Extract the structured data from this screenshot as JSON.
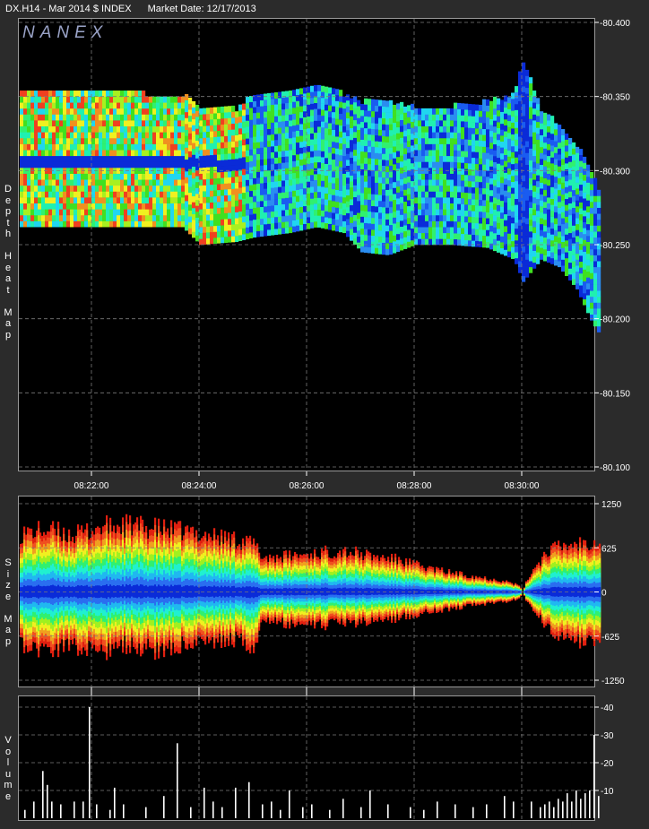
{
  "header": {
    "symbol": "DX.H14 - Mar 2014 $ INDEX",
    "market_date": "Market Date: 12/17/2013"
  },
  "watermark": "NANEX",
  "panels": {
    "heat": {
      "label": "Depth Heat Map"
    },
    "size": {
      "label": "Size Map"
    },
    "volume": {
      "label": "Volume"
    }
  },
  "chart_data": [
    {
      "type": "heatmap",
      "title": "",
      "xlabel": "",
      "ylabel": "Depth Heat Map",
      "x_ticks": [
        "08:22:00",
        "08:24:00",
        "08:26:00",
        "08:28:00",
        "08:30:00"
      ],
      "y_ticks": [
        "80.400",
        "80.350",
        "80.300",
        "80.250",
        "80.200",
        "80.150",
        "80.100"
      ],
      "ylim": [
        80.1,
        80.4
      ],
      "xlim": [
        "08:20:40",
        "08:31:30"
      ],
      "grid": true,
      "price_band": [
        {
          "t": "08:20:40",
          "low": 80.262,
          "high": 80.352
        },
        {
          "t": "08:21:40",
          "low": 80.262,
          "high": 80.352
        },
        {
          "t": "08:22:10",
          "low": 80.262,
          "high": 80.352
        },
        {
          "t": "08:23:00",
          "low": 80.262,
          "high": 80.35
        },
        {
          "t": "08:23:40",
          "low": 80.262,
          "high": 80.35
        },
        {
          "t": "08:24:00",
          "low": 80.25,
          "high": 80.34
        },
        {
          "t": "08:24:40",
          "low": 80.252,
          "high": 80.34
        },
        {
          "t": "08:25:00",
          "low": 80.255,
          "high": 80.35
        },
        {
          "t": "08:25:40",
          "low": 80.258,
          "high": 80.352
        },
        {
          "t": "08:26:10",
          "low": 80.262,
          "high": 80.355
        },
        {
          "t": "08:26:40",
          "low": 80.258,
          "high": 80.35
        },
        {
          "t": "08:27:00",
          "low": 80.245,
          "high": 80.345
        },
        {
          "t": "08:27:30",
          "low": 80.243,
          "high": 80.345
        },
        {
          "t": "08:28:00",
          "low": 80.25,
          "high": 80.342
        },
        {
          "t": "08:28:40",
          "low": 80.25,
          "high": 80.342
        },
        {
          "t": "08:29:20",
          "low": 80.248,
          "high": 80.345
        },
        {
          "t": "08:29:50",
          "low": 80.24,
          "high": 80.35
        },
        {
          "t": "08:30:00",
          "low": 80.225,
          "high": 80.372
        },
        {
          "t": "08:30:20",
          "low": 80.24,
          "high": 80.34
        },
        {
          "t": "08:30:40",
          "low": 80.235,
          "high": 80.33
        },
        {
          "t": "08:31:00",
          "low": 80.22,
          "high": 80.315
        },
        {
          "t": "08:31:15",
          "low": 80.2,
          "high": 80.3
        },
        {
          "t": "08:31:25",
          "low": 80.19,
          "high": 80.285
        }
      ]
    },
    {
      "type": "area",
      "title": "",
      "ylabel": "Size Map",
      "y_ticks": [
        "1250",
        "625",
        "0",
        "-625",
        "-1250"
      ],
      "ylim": [
        -1250,
        1250
      ],
      "grid": true,
      "envelope": [
        {
          "t": "08:20:40",
          "bid": 850,
          "ask": -800
        },
        {
          "t": "08:21:10",
          "bid": 900,
          "ask": -820
        },
        {
          "t": "08:21:40",
          "bid": 820,
          "ask": -780
        },
        {
          "t": "08:22:10",
          "bid": 940,
          "ask": -860
        },
        {
          "t": "08:22:40",
          "bid": 960,
          "ask": -760
        },
        {
          "t": "08:23:10",
          "bid": 920,
          "ask": -840
        },
        {
          "t": "08:23:40",
          "bid": 880,
          "ask": -760
        },
        {
          "t": "08:24:10",
          "bid": 820,
          "ask": -720
        },
        {
          "t": "08:24:40",
          "bid": 760,
          "ask": -700
        },
        {
          "t": "08:25:00",
          "bid": 700,
          "ask": -800
        },
        {
          "t": "08:25:10",
          "bid": 500,
          "ask": -420
        },
        {
          "t": "08:25:40",
          "bid": 520,
          "ask": -460
        },
        {
          "t": "08:26:10",
          "bid": 560,
          "ask": -480
        },
        {
          "t": "08:26:40",
          "bid": 600,
          "ask": -460
        },
        {
          "t": "08:27:10",
          "bid": 520,
          "ask": -420
        },
        {
          "t": "08:27:40",
          "bid": 470,
          "ask": -380
        },
        {
          "t": "08:28:10",
          "bid": 360,
          "ask": -300
        },
        {
          "t": "08:28:40",
          "bid": 280,
          "ask": -240
        },
        {
          "t": "08:29:10",
          "bid": 220,
          "ask": -190
        },
        {
          "t": "08:29:40",
          "bid": 160,
          "ask": -150
        },
        {
          "t": "08:29:55",
          "bid": 100,
          "ask": -100
        },
        {
          "t": "08:30:00",
          "bid": 20,
          "ask": -20
        },
        {
          "t": "08:30:10",
          "bid": 300,
          "ask": -250
        },
        {
          "t": "08:30:30",
          "bid": 620,
          "ask": -560
        },
        {
          "t": "08:31:00",
          "bid": 700,
          "ask": -720
        },
        {
          "t": "08:31:25",
          "bid": 760,
          "ask": -800
        }
      ]
    },
    {
      "type": "bar",
      "title": "",
      "ylabel": "Volume",
      "y_ticks": [
        "40",
        "30",
        "20",
        "10"
      ],
      "ylim": [
        0,
        42
      ],
      "grid": true,
      "bars": [
        {
          "t": "08:20:45",
          "v": 3
        },
        {
          "t": "08:20:55",
          "v": 6
        },
        {
          "t": "08:21:05",
          "v": 17
        },
        {
          "t": "08:21:10",
          "v": 12
        },
        {
          "t": "08:21:15",
          "v": 6
        },
        {
          "t": "08:21:25",
          "v": 5
        },
        {
          "t": "08:21:40",
          "v": 6
        },
        {
          "t": "08:21:50",
          "v": 6
        },
        {
          "t": "08:21:57",
          "v": 40
        },
        {
          "t": "08:22:05",
          "v": 5
        },
        {
          "t": "08:22:20",
          "v": 3
        },
        {
          "t": "08:22:25",
          "v": 11
        },
        {
          "t": "08:22:35",
          "v": 5
        },
        {
          "t": "08:23:00",
          "v": 4
        },
        {
          "t": "08:23:20",
          "v": 8
        },
        {
          "t": "08:23:35",
          "v": 27
        },
        {
          "t": "08:23:50",
          "v": 4
        },
        {
          "t": "08:24:05",
          "v": 11
        },
        {
          "t": "08:24:15",
          "v": 6
        },
        {
          "t": "08:24:25",
          "v": 4
        },
        {
          "t": "08:24:40",
          "v": 11
        },
        {
          "t": "08:24:55",
          "v": 13
        },
        {
          "t": "08:25:10",
          "v": 5
        },
        {
          "t": "08:25:20",
          "v": 6
        },
        {
          "t": "08:25:30",
          "v": 3
        },
        {
          "t": "08:25:40",
          "v": 10
        },
        {
          "t": "08:25:55",
          "v": 4
        },
        {
          "t": "08:26:05",
          "v": 5
        },
        {
          "t": "08:26:25",
          "v": 3
        },
        {
          "t": "08:26:40",
          "v": 7
        },
        {
          "t": "08:27:00",
          "v": 4
        },
        {
          "t": "08:27:10",
          "v": 10
        },
        {
          "t": "08:27:30",
          "v": 5
        },
        {
          "t": "08:27:55",
          "v": 4
        },
        {
          "t": "08:28:10",
          "v": 3
        },
        {
          "t": "08:28:25",
          "v": 6
        },
        {
          "t": "08:28:45",
          "v": 5
        },
        {
          "t": "08:29:05",
          "v": 4
        },
        {
          "t": "08:29:20",
          "v": 5
        },
        {
          "t": "08:29:40",
          "v": 8
        },
        {
          "t": "08:29:50",
          "v": 6
        },
        {
          "t": "08:30:10",
          "v": 6
        },
        {
          "t": "08:30:20",
          "v": 4
        },
        {
          "t": "08:30:25",
          "v": 5
        },
        {
          "t": "08:30:30",
          "v": 6
        },
        {
          "t": "08:30:35",
          "v": 4
        },
        {
          "t": "08:30:40",
          "v": 7
        },
        {
          "t": "08:30:45",
          "v": 6
        },
        {
          "t": "08:30:50",
          "v": 9
        },
        {
          "t": "08:30:55",
          "v": 6
        },
        {
          "t": "08:31:00",
          "v": 10
        },
        {
          "t": "08:31:05",
          "v": 7
        },
        {
          "t": "08:31:10",
          "v": 9
        },
        {
          "t": "08:31:15",
          "v": 10
        },
        {
          "t": "08:31:20",
          "v": 30
        },
        {
          "t": "08:31:25",
          "v": 8
        }
      ]
    }
  ],
  "colors": {
    "background": "#2b2b2b",
    "plot_bg": "#000000",
    "grid": "#7a7a7a",
    "heat_palette": [
      "#0a2bd8",
      "#1a5cf0",
      "#2a8df0",
      "#20d6f0",
      "#20f0b0",
      "#30f070",
      "#40e020",
      "#a8f020",
      "#f0f020",
      "#f09020",
      "#f04020"
    ]
  }
}
